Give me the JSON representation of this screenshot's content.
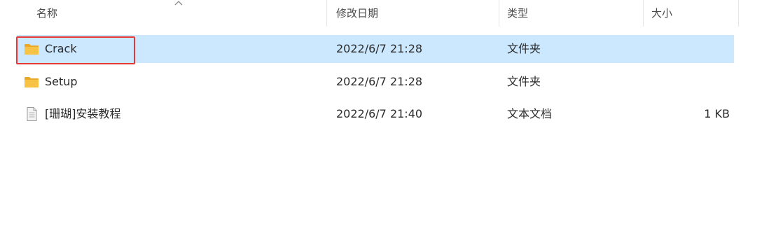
{
  "columns": {
    "name": "名称",
    "modified": "修改日期",
    "type": "类型",
    "size": "大小"
  },
  "files": [
    {
      "name": "Crack",
      "modified": "2022/6/7 21:28",
      "type": "文件夹",
      "size": "",
      "icon": "folder-icon",
      "selected": true
    },
    {
      "name": "Setup",
      "modified": "2022/6/7 21:28",
      "type": "文件夹",
      "size": "",
      "icon": "folder-icon",
      "selected": false
    },
    {
      "name": "[珊瑚]安装教程",
      "modified": "2022/6/7 21:40",
      "type": "文本文档",
      "size": "1 KB",
      "icon": "text-document-icon",
      "selected": false
    }
  ],
  "colors": {
    "selection": "#cce8ff",
    "annotation_box": "#e53935",
    "folder": "#f6c344"
  }
}
